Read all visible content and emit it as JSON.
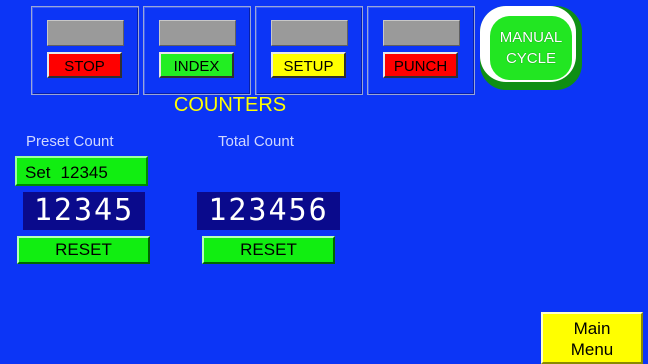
{
  "modes": [
    {
      "label": "STOP",
      "color": "#ff0000"
    },
    {
      "label": "INDEX",
      "color": "#22ee22"
    },
    {
      "label": "SETUP",
      "color": "#ffff00"
    },
    {
      "label": "PUNCH",
      "color": "#ff0000"
    }
  ],
  "manual_cycle": {
    "line1": "MANUAL",
    "line2": "CYCLE",
    "color": "#22e622"
  },
  "heading": "COUNTERS",
  "preset": {
    "label": "Preset Count",
    "set_prefix": "Set",
    "set_value": "12345",
    "value": "12345",
    "reset_label": "RESET"
  },
  "total": {
    "label": "Total Count",
    "value": "123456",
    "reset_label": "RESET"
  },
  "main_menu": {
    "line1": "Main",
    "line2": "Menu"
  },
  "colors": {
    "background": "#0c35f6",
    "accent_yellow": "#ffff00",
    "accent_green": "#11ee11"
  }
}
